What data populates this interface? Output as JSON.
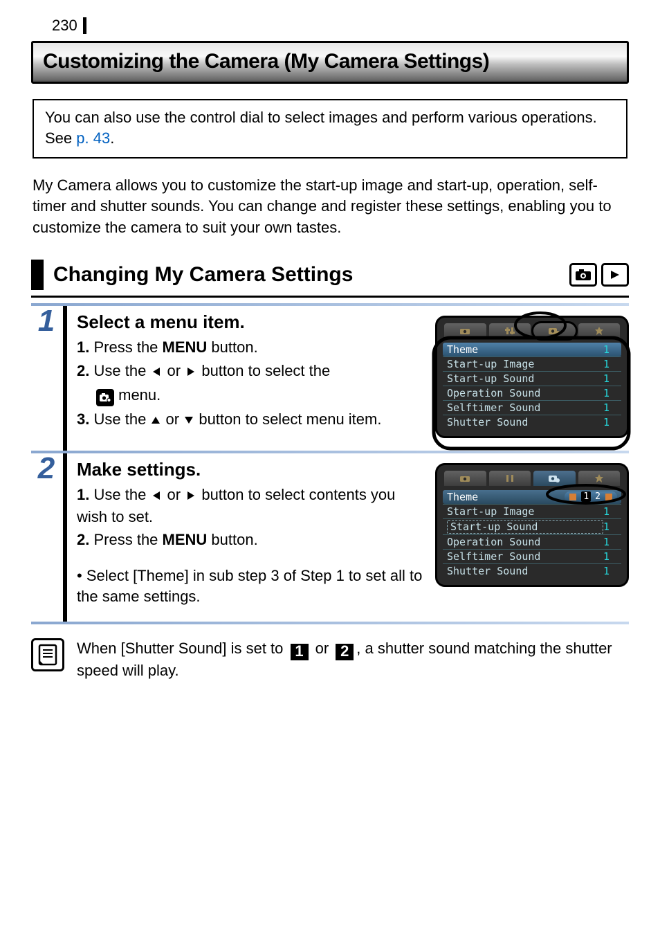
{
  "page_number": "230",
  "title": "Customizing the Camera (My Camera Settings)",
  "note": {
    "text_before_link": "You can also use the control dial to select images and perform various operations. See ",
    "link_text": "p. 43",
    "text_after_link": "."
  },
  "intro_paragraph": "My Camera allows you to customize the start-up image and start-up, operation, self-timer and shutter sounds. You can change and register these settings, enabling you to customize the camera to suit your own tastes.",
  "section_heading": "Changing My Camera Settings",
  "steps": [
    {
      "number": "1",
      "heading": "Select a menu item.",
      "lines": {
        "l1_prefix": "1.",
        "l1_a": "Press the ",
        "l1_menu": "MENU",
        "l1_b": " button.",
        "l2_prefix": "2.",
        "l2_a": "Use the ",
        "l2_b": " or ",
        "l2_c": " button to select the ",
        "l2_menu_after": " menu.",
        "l3_prefix": "3.",
        "l3_a": "Use the ",
        "l3_b": " or ",
        "l3_c": " button to select menu item."
      },
      "lcd": {
        "rows": [
          {
            "label": "Theme",
            "val": "1"
          },
          {
            "label": "Start-up Image",
            "val": "1"
          },
          {
            "label": "Start-up Sound",
            "val": "1"
          },
          {
            "label": "Operation Sound",
            "val": "1"
          },
          {
            "label": "Selftimer Sound",
            "val": "1"
          },
          {
            "label": "Shutter Sound",
            "val": "1"
          }
        ]
      }
    },
    {
      "number": "2",
      "heading": "Make settings.",
      "lines": {
        "l1_prefix": "1.",
        "l1_a": "Use the ",
        "l1_b": " or ",
        "l1_c": " button to select contents you wish to set.",
        "l2_prefix": "2.",
        "l2_a": "Press the ",
        "l2_menu": "MENU",
        "l2_b": " button.",
        "bullet": "• Select [Theme] in sub step 3 of Step 1 to set all to the same settings."
      },
      "lcd": {
        "rows": [
          {
            "label": "Theme",
            "val": "",
            "theme_options": [
              "1",
              "2"
            ]
          },
          {
            "label": "Start-up Image",
            "val": "1"
          },
          {
            "label": "Start-up Sound",
            "val": "1"
          },
          {
            "label": "Operation Sound",
            "val": "1"
          },
          {
            "label": "Selftimer Sound",
            "val": "1"
          },
          {
            "label": "Shutter Sound",
            "val": "1"
          }
        ]
      }
    }
  ],
  "tip": {
    "a": "When [Shutter Sound] is set to ",
    "badge1": "1",
    "b": " or ",
    "badge2": "2",
    "c": ", a shutter sound matching the shutter speed will play."
  }
}
